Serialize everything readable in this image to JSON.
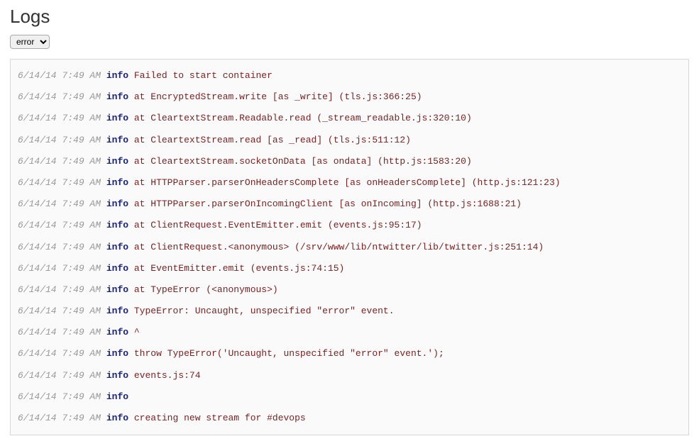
{
  "title": "Logs",
  "filter": {
    "selected": "error"
  },
  "logs": [
    {
      "timestamp": "6/14/14 7:49 AM",
      "level": "info",
      "message": "Failed to start container"
    },
    {
      "timestamp": "6/14/14 7:49 AM",
      "level": "info",
      "message": "at EncryptedStream.write [as _write] (tls.js:366:25)"
    },
    {
      "timestamp": "6/14/14 7:49 AM",
      "level": "info",
      "message": "at CleartextStream.Readable.read (_stream_readable.js:320:10)"
    },
    {
      "timestamp": "6/14/14 7:49 AM",
      "level": "info",
      "message": "at CleartextStream.read [as _read] (tls.js:511:12)"
    },
    {
      "timestamp": "6/14/14 7:49 AM",
      "level": "info",
      "message": "at CleartextStream.socketOnData [as ondata] (http.js:1583:20)"
    },
    {
      "timestamp": "6/14/14 7:49 AM",
      "level": "info",
      "message": "at HTTPParser.parserOnHeadersComplete [as onHeadersComplete] (http.js:121:23)"
    },
    {
      "timestamp": "6/14/14 7:49 AM",
      "level": "info",
      "message": "at HTTPParser.parserOnIncomingClient [as onIncoming] (http.js:1688:21)"
    },
    {
      "timestamp": "6/14/14 7:49 AM",
      "level": "info",
      "message": "at ClientRequest.EventEmitter.emit (events.js:95:17)"
    },
    {
      "timestamp": "6/14/14 7:49 AM",
      "level": "info",
      "message": "at ClientRequest.<anonymous> (/srv/www/lib/ntwitter/lib/twitter.js:251:14)"
    },
    {
      "timestamp": "6/14/14 7:49 AM",
      "level": "info",
      "message": "at EventEmitter.emit (events.js:74:15)"
    },
    {
      "timestamp": "6/14/14 7:49 AM",
      "level": "info",
      "message": "at TypeError (<anonymous>)"
    },
    {
      "timestamp": "6/14/14 7:49 AM",
      "level": "info",
      "message": "TypeError: Uncaught, unspecified \"error\" event."
    },
    {
      "timestamp": "6/14/14 7:49 AM",
      "level": "info",
      "message": "^"
    },
    {
      "timestamp": "6/14/14 7:49 AM",
      "level": "info",
      "message": "throw TypeError('Uncaught, unspecified \"error\" event.');"
    },
    {
      "timestamp": "6/14/14 7:49 AM",
      "level": "info",
      "message": "events.js:74"
    },
    {
      "timestamp": "6/14/14 7:49 AM",
      "level": "info",
      "message": ""
    },
    {
      "timestamp": "6/14/14 7:49 AM",
      "level": "info",
      "message": "creating new stream for #devops"
    }
  ]
}
